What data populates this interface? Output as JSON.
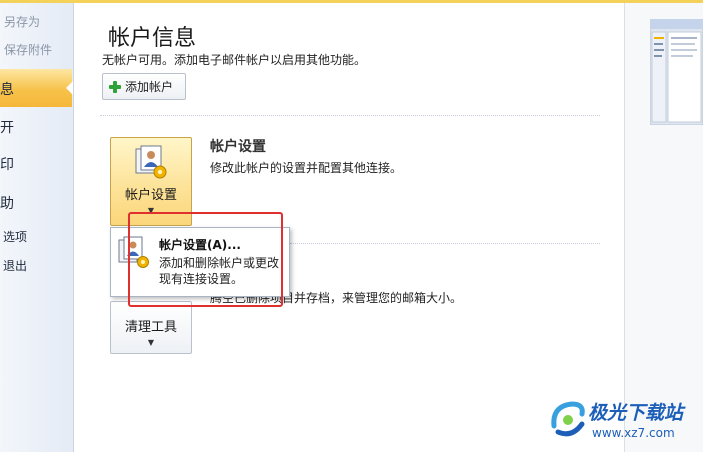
{
  "nav": {
    "items": [
      {
        "label": "另存为"
      },
      {
        "label": "保存附件"
      },
      {
        "label": "息"
      },
      {
        "label": "开"
      },
      {
        "label": "印"
      },
      {
        "label": "助"
      },
      {
        "label": "选项"
      },
      {
        "label": "退出"
      }
    ]
  },
  "main": {
    "title": "帐户信息",
    "subtitle": "无帐户可用。添加电子邮件帐户以启用其他功能。",
    "add_account_label": "添加帐户",
    "account_settings": {
      "button_label": "帐户设置",
      "caret": "▼",
      "title": "帐户设置",
      "description": "修改此帐户的设置并配置其他连接。"
    },
    "cleanup": {
      "button_label": "清理工具",
      "caret": "▼",
      "description": "腾空已删除项目并存档，来管理您的邮箱大小。"
    },
    "popup": {
      "title": "帐户设置(A)...",
      "description": "添加和删除帐户或更改现有连接设置。"
    }
  },
  "watermark": {
    "brand": "极光下载站",
    "url": "www.xz7.com"
  },
  "colors": {
    "selected_nav": "#f7c24a",
    "highlight": "#e0302d",
    "watermark": "#1d5fb8"
  }
}
